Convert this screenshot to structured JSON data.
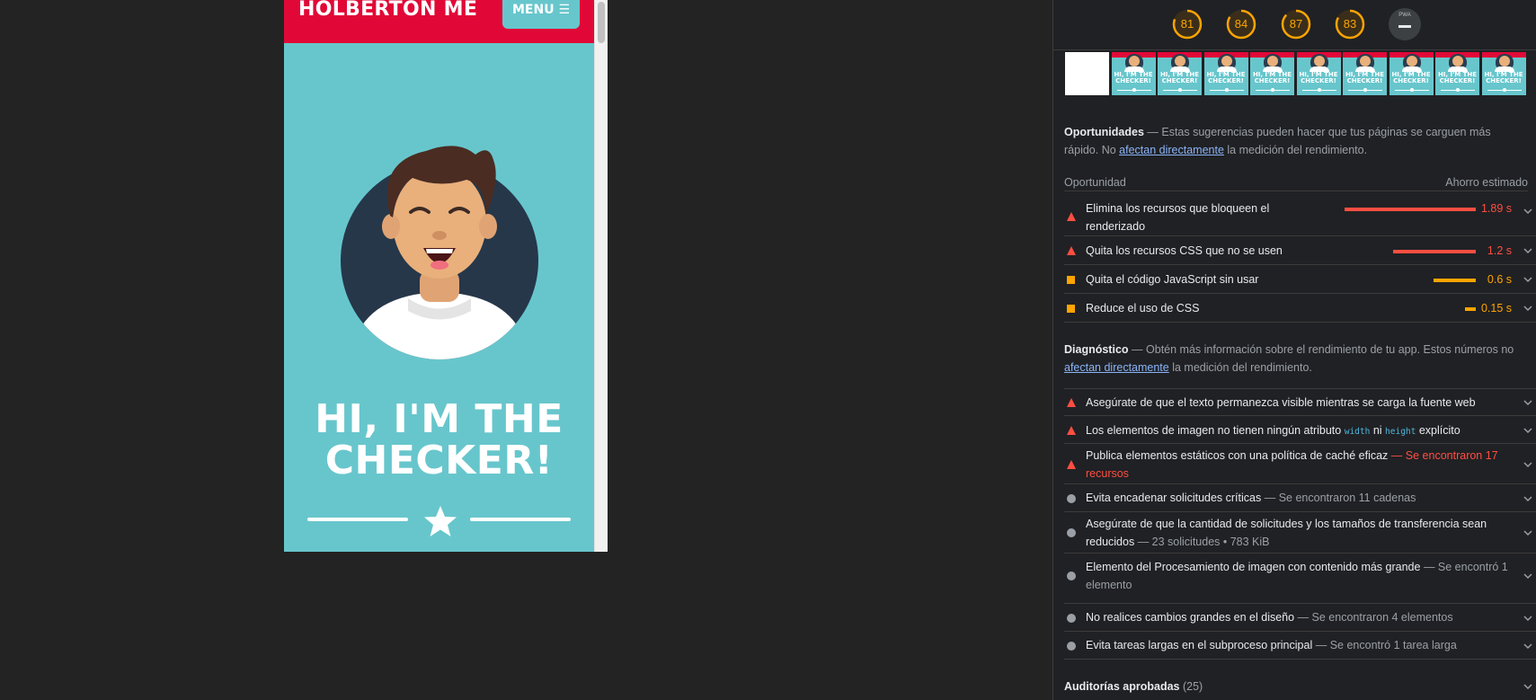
{
  "device": {
    "brand": "HOLBERTON ME",
    "menu_label": "MENU ☰",
    "hero_line1": "HI, I'M THE",
    "hero_line2": "CHECKER!",
    "colors": {
      "header": "#e10837",
      "background": "#67c6cc"
    }
  },
  "scores": [
    {
      "value": "81",
      "fraction": 0.81
    },
    {
      "value": "84",
      "fraction": 0.84
    },
    {
      "value": "87",
      "fraction": 0.87
    },
    {
      "value": "83",
      "fraction": 0.83
    }
  ],
  "pwa": {
    "label": "PWA",
    "value": "—"
  },
  "filmstrip": {
    "frame_text": "HI, I'M THE CHECKER!",
    "frames_total": 10
  },
  "opportunities": {
    "title": "Oportunidades",
    "desc_pre": "Estas sugerencias pueden hacer que tus páginas se carguen más rápido. No",
    "desc_link": "afectan directamente",
    "desc_post": "la medición del rendimiento.",
    "col_left": "Oportunidad",
    "col_right": "Ahorro estimado",
    "items": [
      {
        "label": "Elimina los recursos que bloqueen el renderizado",
        "value": "1.89 s",
        "severity": "fail",
        "fraction": 1.0
      },
      {
        "label": "Quita los recursos CSS que no se usen",
        "value": "1.2 s",
        "severity": "fail",
        "fraction": 0.63
      },
      {
        "label": "Quita el código JavaScript sin usar",
        "value": "0.6 s",
        "severity": "average",
        "fraction": 0.32
      },
      {
        "label": "Reduce el uso de CSS",
        "value": "0.15 s",
        "severity": "average",
        "fraction": 0.08
      }
    ]
  },
  "diagnostics": {
    "title": "Diagnóstico",
    "desc_pre": "Obtén más información sobre el rendimiento de tu app. Estos números no",
    "desc_link": "afectan directamente",
    "desc_post": "la medición del rendimiento.",
    "items": [
      {
        "label": "Asegúrate de que el texto permanezca visible mientras se carga la fuente web",
        "meta": "",
        "severity": "fail"
      },
      {
        "label_pre": "Los elementos de imagen no tienen ningún atributo",
        "code1": "width",
        "mid": "ni",
        "code2": "height",
        "label_post": "explícito",
        "severity": "fail"
      },
      {
        "label": "Publica elementos estáticos con una política de caché eficaz",
        "meta": "Se encontraron 17 recursos",
        "severity": "fail"
      },
      {
        "label": "Evita encadenar solicitudes críticas",
        "meta": "Se encontraron 11 cadenas",
        "severity": "info"
      },
      {
        "label": "Asegúrate de que la cantidad de solicitudes y los tamaños de transferencia sean reducidos",
        "meta": "23 solicitudes • 783 KiB",
        "severity": "info"
      },
      {
        "label": "Elemento del Procesamiento de imagen con contenido más grande",
        "meta": "Se encontró 1 elemento",
        "severity": "info"
      },
      {
        "label": "No realices cambios grandes en el diseño",
        "meta": "Se encontraron 4 elementos",
        "severity": "info"
      },
      {
        "label": "Evita tareas largas en el subproceso principal",
        "meta": "Se encontró 1 tarea larga",
        "severity": "info"
      }
    ]
  },
  "passed": {
    "label": "Auditorías aprobadas",
    "count": "(25)"
  },
  "colors": {
    "fail": "#ff4e42",
    "average": "#ffa400",
    "info": "#9aa0a6",
    "link": "#8ab4f8"
  }
}
